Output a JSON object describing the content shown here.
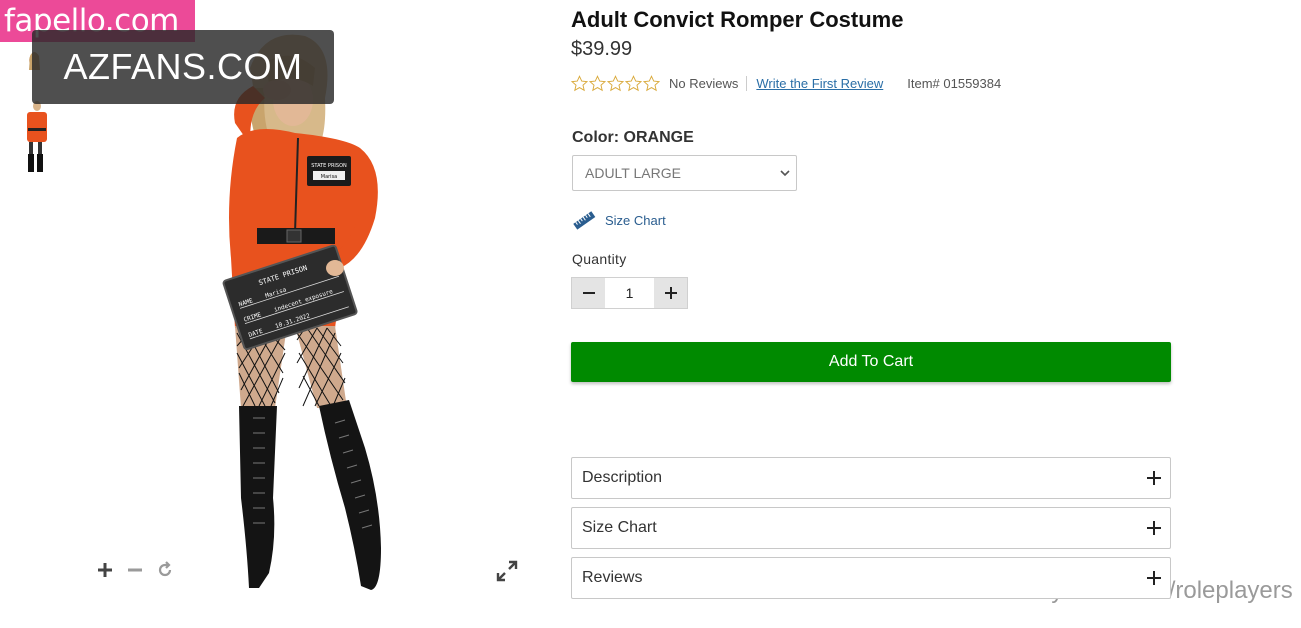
{
  "watermarks": {
    "top": "fapello.com",
    "box": "AZFANS.COM",
    "bottom": "OnlyFans.com/roleplayers"
  },
  "product": {
    "title": "Adult Convict Romper Costume",
    "price": "$39.99",
    "rating": {
      "stars": 0,
      "max": 5,
      "reviews_text": "No Reviews",
      "write_review": "Write the First Review"
    },
    "item_number": "Item# 01559384",
    "color_label": "Color: ORANGE",
    "size_select": {
      "value": "ADULT LARGE"
    },
    "size_chart_link": "Size Chart",
    "quantity": {
      "label": "Quantity",
      "value": "1"
    },
    "add_to_cart": "Add To Cart",
    "accordions": [
      {
        "label": "Description"
      },
      {
        "label": "Size Chart"
      },
      {
        "label": "Reviews"
      }
    ]
  },
  "figure_print": {
    "badge_top": "STATE PRISON",
    "badge_name": "Marisa",
    "board_title": "STATE PRISON",
    "board_name_label": "NAME",
    "board_name": "Marisa",
    "board_crime_label": "CRIME",
    "board_crime": "indecent exposure",
    "board_date_label": "DATE",
    "board_date": "10.31.2022"
  },
  "colors": {
    "accent_green": "#008a00",
    "link_blue": "#2a6ea6",
    "costume_orange": "#e8521e",
    "watermark_pink": "#ec4a98"
  },
  "icons": [
    "star-icon",
    "chevron-down-icon",
    "ruler-icon",
    "minus-icon",
    "plus-icon",
    "zoom-in-icon",
    "zoom-out-icon",
    "reset-icon",
    "expand-icon"
  ]
}
